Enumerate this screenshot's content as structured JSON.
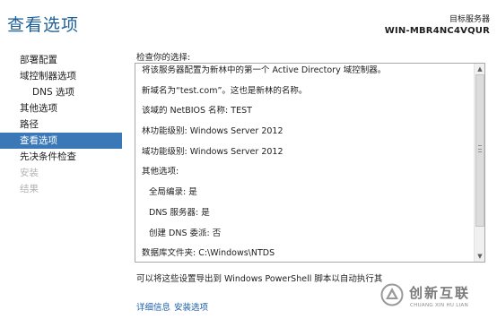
{
  "header": {
    "title": "查看选项",
    "target_label": "目标服务器",
    "target_server": "WIN-MBR4NC4VQUR"
  },
  "nav": {
    "items": [
      {
        "label": "部署配置",
        "state": "normal",
        "level": 0
      },
      {
        "label": "域控制器选项",
        "state": "normal",
        "level": 0
      },
      {
        "label": "DNS 选项",
        "state": "normal",
        "level": 1
      },
      {
        "label": "其他选项",
        "state": "normal",
        "level": 0
      },
      {
        "label": "路径",
        "state": "normal",
        "level": 0
      },
      {
        "label": "查看选项",
        "state": "active",
        "level": 0
      },
      {
        "label": "先决条件检查",
        "state": "normal",
        "level": 0
      },
      {
        "label": "安装",
        "state": "disabled",
        "level": 0
      },
      {
        "label": "结果",
        "state": "disabled",
        "level": 0
      }
    ]
  },
  "review": {
    "label": "检查你的选择:",
    "lines": [
      {
        "text": "将该服务器配置为新林中的第一个 Active Directory 域控制器。",
        "indent": false
      },
      {
        "text": "新域名为“test.com”。这也是新林的名称。",
        "indent": false
      },
      {
        "text": "该域的 NetBIOS 名称: TEST",
        "indent": false
      },
      {
        "text": "林功能级别: Windows Server 2012",
        "indent": false
      },
      {
        "text": "域功能级别: Windows Server 2012",
        "indent": false
      },
      {
        "text": "其他选项:",
        "indent": false
      },
      {
        "text": "全局编录: 是",
        "indent": true
      },
      {
        "text": "DNS 服务器: 是",
        "indent": true
      },
      {
        "text": "创建 DNS 委派: 否",
        "indent": true
      },
      {
        "text": "数据库文件夹: C:\\Windows\\NTDS",
        "indent": false
      }
    ],
    "scroll_position": 0.0
  },
  "export_note": "可以将这些设置导出到 Windows PowerShell 脚本以自动执行其",
  "links": {
    "more_info": "详细信息",
    "install_options": "安装选项"
  },
  "watermark": {
    "brand": "创新互联",
    "sub": "CHUANG XIN HU LIAN"
  },
  "colors": {
    "title": "#1d5f99",
    "nav_active_bg": "#3b78b8",
    "link": "#1a5fa8",
    "disabled_text": "#b3b3b3"
  }
}
